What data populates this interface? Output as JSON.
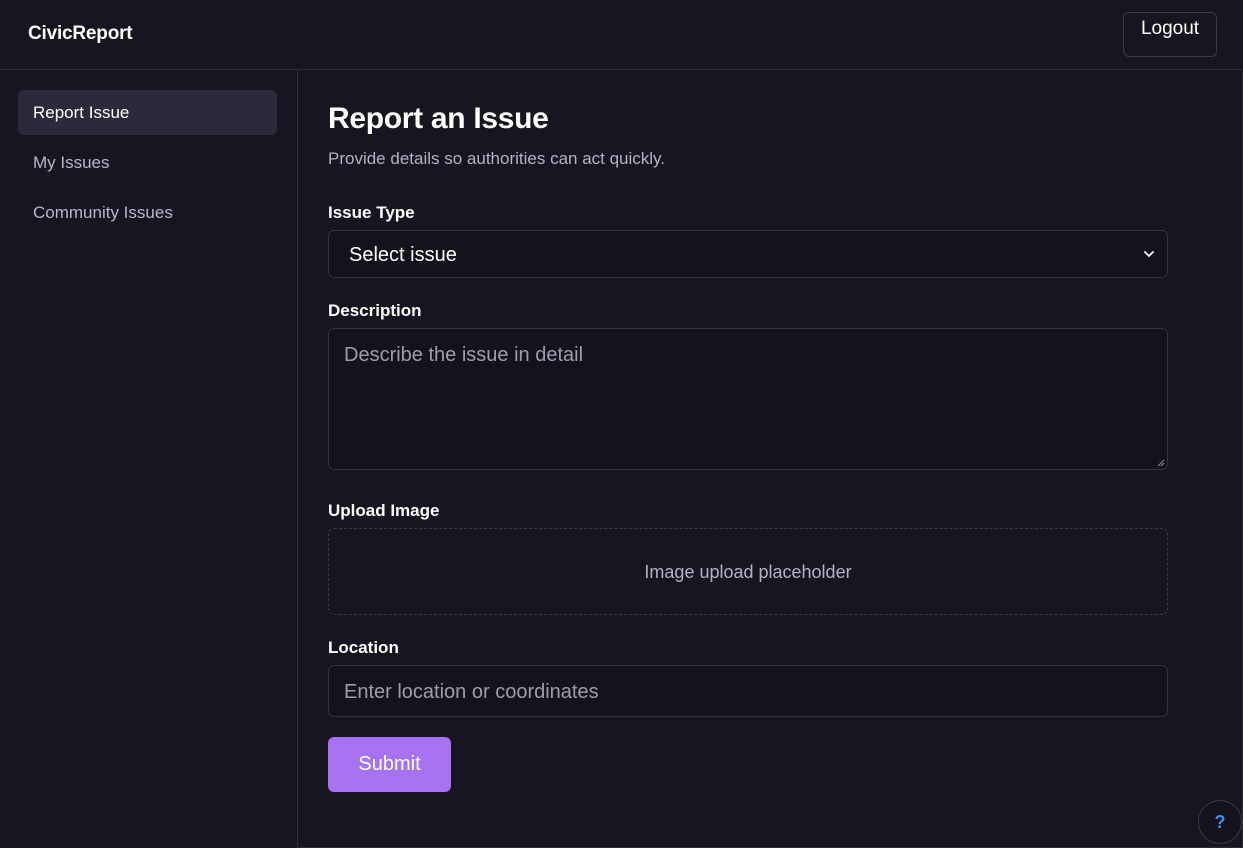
{
  "header": {
    "brand": "CivicReport",
    "logout_label": "Logout"
  },
  "sidebar": {
    "items": [
      {
        "label": "Report Issue",
        "active": true
      },
      {
        "label": "My Issues",
        "active": false
      },
      {
        "label": "Community Issues",
        "active": false
      }
    ]
  },
  "main": {
    "title": "Report an Issue",
    "subtitle": "Provide details so authorities can act quickly.",
    "issue_type": {
      "label": "Issue Type",
      "selected": "Select issue"
    },
    "description": {
      "label": "Description",
      "placeholder": "Describe the issue in detail"
    },
    "upload": {
      "label": "Upload Image",
      "placeholder": "Image upload placeholder"
    },
    "location": {
      "label": "Location",
      "placeholder": "Enter location or coordinates"
    },
    "submit_label": "Submit"
  },
  "help": {
    "glyph": "?"
  },
  "colors": {
    "background": "#161520",
    "accent": "#a772f1",
    "active_nav": "#2b2a3a",
    "help_glyph": "#3f8cff"
  },
  "icons": [
    "chevron-down-icon",
    "resize-grip-icon",
    "help-icon"
  ]
}
